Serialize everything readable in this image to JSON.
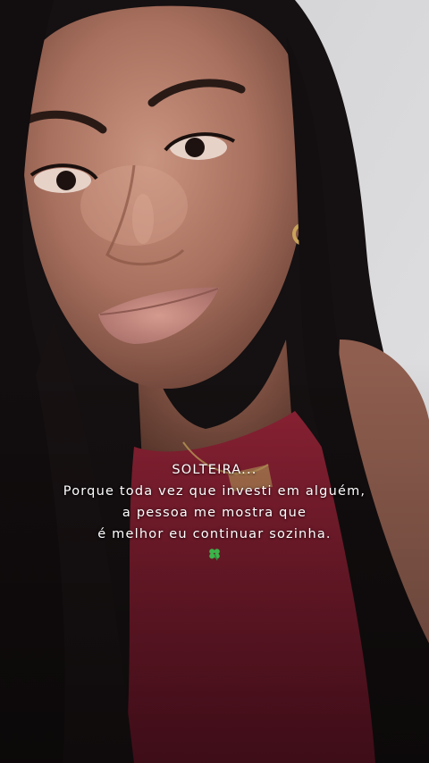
{
  "photo": {
    "description_icon": "portrait-photo",
    "colors": {
      "background_wall": "#d6d6d8",
      "hair": "#141010",
      "skin": "#b07c6a",
      "top": "#8a1f32"
    }
  },
  "caption": {
    "title": "SOLTEIRA...",
    "line1": "Porque toda vez que investi em alguém,",
    "line2": "a pessoa me mostra que",
    "line3": "é melhor eu continuar sozinha.",
    "emoji_icon": "four-leaf-clover-icon",
    "clover_color": "#3cb44a"
  }
}
